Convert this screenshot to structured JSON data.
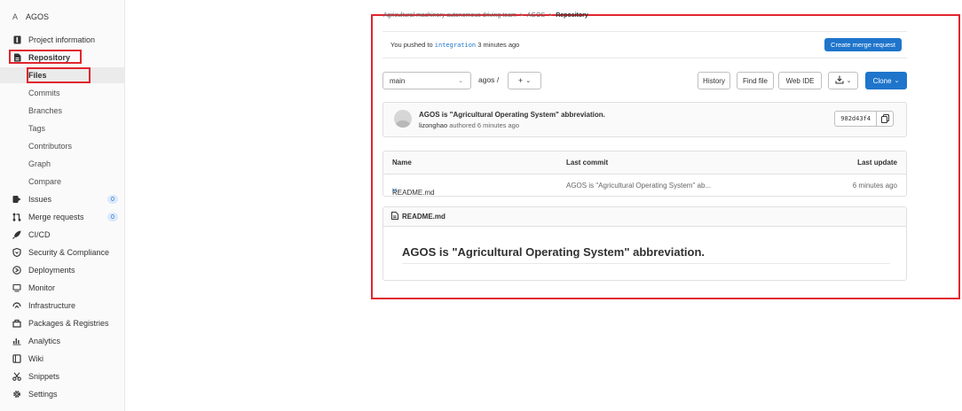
{
  "project": {
    "avatar_letter": "A",
    "name": "AGOS"
  },
  "sidebar": {
    "items": [
      {
        "label": "Project information",
        "icon": "info-icon"
      },
      {
        "label": "Repository",
        "icon": "file-icon"
      },
      {
        "label": "Files"
      },
      {
        "label": "Commits"
      },
      {
        "label": "Branches"
      },
      {
        "label": "Tags"
      },
      {
        "label": "Contributors"
      },
      {
        "label": "Graph"
      },
      {
        "label": "Compare"
      },
      {
        "label": "Issues",
        "icon": "issues-icon",
        "count": "0"
      },
      {
        "label": "Merge requests",
        "icon": "merge-request-icon",
        "count": "0"
      },
      {
        "label": "CI/CD",
        "icon": "rocket-icon"
      },
      {
        "label": "Security & Compliance",
        "icon": "shield-icon"
      },
      {
        "label": "Deployments",
        "icon": "deployments-icon"
      },
      {
        "label": "Monitor",
        "icon": "monitor-icon"
      },
      {
        "label": "Infrastructure",
        "icon": "cloud-icon"
      },
      {
        "label": "Packages & Registries",
        "icon": "package-icon"
      },
      {
        "label": "Analytics",
        "icon": "chart-icon"
      },
      {
        "label": "Wiki",
        "icon": "book-icon"
      },
      {
        "label": "Snippets",
        "icon": "scissors-icon"
      },
      {
        "label": "Settings",
        "icon": "gear-icon"
      }
    ]
  },
  "breadcrumb": {
    "group": "Agricultural machinery autonomous driving team",
    "project": "AGOS",
    "current": "Repository",
    "separator": ">"
  },
  "push_notice": {
    "prefix": "You pushed to",
    "branch": "integration",
    "suffix": "3 minutes ago",
    "button": "Create merge request"
  },
  "toolbar": {
    "branch_select": "main",
    "path": "agos",
    "path_sep": "/",
    "add_label": "+",
    "history": "History",
    "find_file": "Find file",
    "web_ide": "Web IDE",
    "clone": "Clone"
  },
  "last_commit": {
    "title": "AGOS is \"Agricultural Operating System\" abbreviation.",
    "author": "lizonghao",
    "meta": "authored 6 minutes ago",
    "sha": "982d43f4"
  },
  "file_table": {
    "headers": {
      "name": "Name",
      "last_commit": "Last commit",
      "last_update": "Last update"
    },
    "rows": [
      {
        "name": "README.md",
        "commit": "AGOS is \"Agricultural Operating System\" ab...",
        "updated": "6 minutes ago"
      }
    ]
  },
  "readme": {
    "filename": "README.md",
    "heading": "AGOS is \"Agricultural Operating System\" abbreviation."
  },
  "colors": {
    "accent": "#1f75cb",
    "highlight": "#e0262e"
  }
}
